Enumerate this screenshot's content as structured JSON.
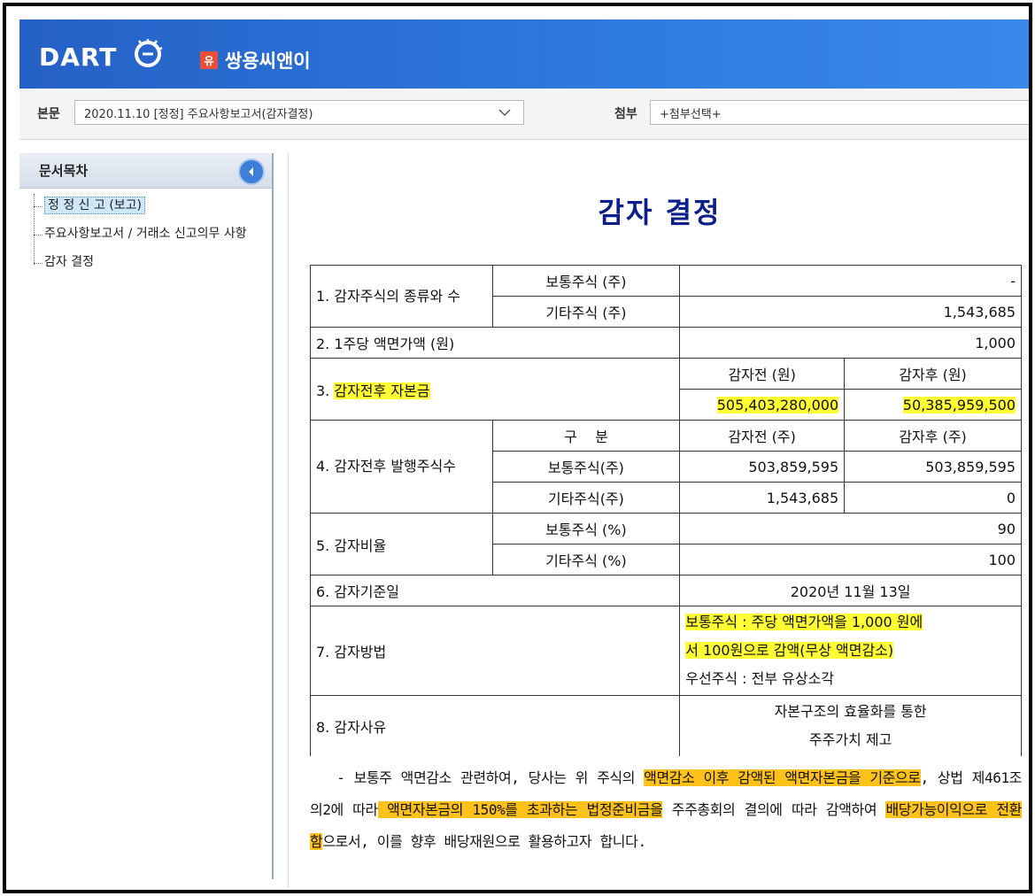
{
  "header": {
    "logo_text": "DART",
    "company_badge": "유",
    "company_name": "쌍용씨앤이"
  },
  "toolbar": {
    "body_label": "본문",
    "body_select_value": "2020.11.10  [정정] 주요사항보고서(감자결정)",
    "attach_label": "첨부",
    "attach_select_value": "+첨부선택+"
  },
  "sidebar": {
    "title": "문서목차",
    "items": [
      {
        "label": "정 정 신 고 (보고)"
      },
      {
        "label": "주요사항보고서 / 거래소 신고의무 사항"
      },
      {
        "label": "감자 결정"
      }
    ]
  },
  "document": {
    "title": "감자 결정",
    "rows": {
      "r1_label": "1. 감자주식의 종류와 수",
      "r1_common_label": "보통주식 (주)",
      "r1_common_value": "-",
      "r1_other_label": "기타주식 (주)",
      "r1_other_value": "1,543,685",
      "r2_label": "2. 1주당 액면가액 (원)",
      "r2_value": "1,000",
      "r3_label_prefix": "3. ",
      "r3_label_hl": "감자전후 자본금",
      "r3_before_head": "감자전 (원)",
      "r3_after_head": "감자후 (원)",
      "r3_before_value": "505,403,280,000",
      "r3_after_value": "50,385,959,500",
      "r4_label": "4. 감자전후 발행주식수",
      "r4_div_head": "구    분",
      "r4_before_head": "감자전 (주)",
      "r4_after_head": "감자후 (주)",
      "r4_common_label": "보통주식(주)",
      "r4_common_before": "503,859,595",
      "r4_common_after": "503,859,595",
      "r4_other_label": "기타주식(주)",
      "r4_other_before": "1,543,685",
      "r4_other_after": "0",
      "r5_label": "5. 감자비율",
      "r5_common_label": "보통주식 (%)",
      "r5_common_value": "90",
      "r5_other_label": "기타주식 (%)",
      "r5_other_value": "100",
      "r6_label": "6. 감자기준일",
      "r6_value": "2020년 11월 13일",
      "r7_label": "7. 감자방법",
      "r7_line1": "보통주식 : 주당 액면가액을 1,000 원에",
      "r7_line2": "서 100원으로 감액(무상 액면감소)",
      "r7_line3": "우선주식 : 전부 유상소각",
      "r8_label": "8. 감자사유",
      "r8_line1": "자본구조의 효율화를 통한",
      "r8_line2": "주주가치 제고"
    },
    "paragraph": {
      "p1": "   - 보통주 액면감소 관련하여, 당사는 위 주식의 ",
      "h1": "액면감소 이후 감액된 액면자본금을 기준으로",
      "p2": ", 상법 제461조의2에 따라",
      "h2": " 액면자본금의 150%를 초과하는 법정준비금을",
      "p3": " 주주총회의 결의에 따라 감액하여 ",
      "h3": "배당가능이익으로 전환함",
      "p4": "으로서, 이를 향후 배당재원으로 활용하고자 합니다."
    }
  },
  "colors": {
    "header_blue": "#2f7ae0",
    "title_navy": "#0c1f8a",
    "highlight_yellow": "#ffff33",
    "highlight_orange": "#ffc21a"
  }
}
